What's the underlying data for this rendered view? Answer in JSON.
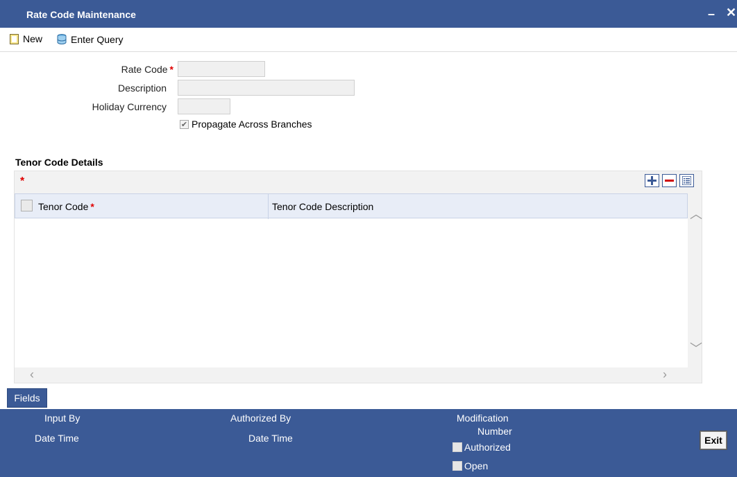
{
  "window": {
    "title": "Rate Code Maintenance",
    "minimize_glyph": "–",
    "close_glyph": "✕"
  },
  "toolbar": {
    "new_label": "New",
    "enter_query_label": "Enter Query"
  },
  "form": {
    "rate_code_label": "Rate Code",
    "rate_code_value": "",
    "description_label": "Description",
    "description_value": "",
    "holiday_currency_label": "Holiday Currency",
    "holiday_currency_value": "",
    "propagate_label": "Propagate Across Branches",
    "propagate_checked": true,
    "required_marker": "*"
  },
  "tenor_section": {
    "title": "Tenor Code Details",
    "required_marker": "*",
    "columns": [
      "Tenor Code",
      "Tenor Code Description"
    ],
    "rows": [],
    "buttons": {
      "add": "plus-icon",
      "remove": "minus-icon",
      "view": "list-icon"
    }
  },
  "footer": {
    "fields_tab": "Fields",
    "input_by_label": "Input By",
    "date_time_label_1": "Date Time",
    "authorized_by_label": "Authorized By",
    "date_time_label_2": "Date Time",
    "modification_label": "Modification",
    "number_label": "Number",
    "authorized_label": "Authorized",
    "open_label": "Open",
    "exit_label": "Exit"
  },
  "colors": {
    "header_blue": "#3b5a96",
    "required_red": "#e00000"
  }
}
